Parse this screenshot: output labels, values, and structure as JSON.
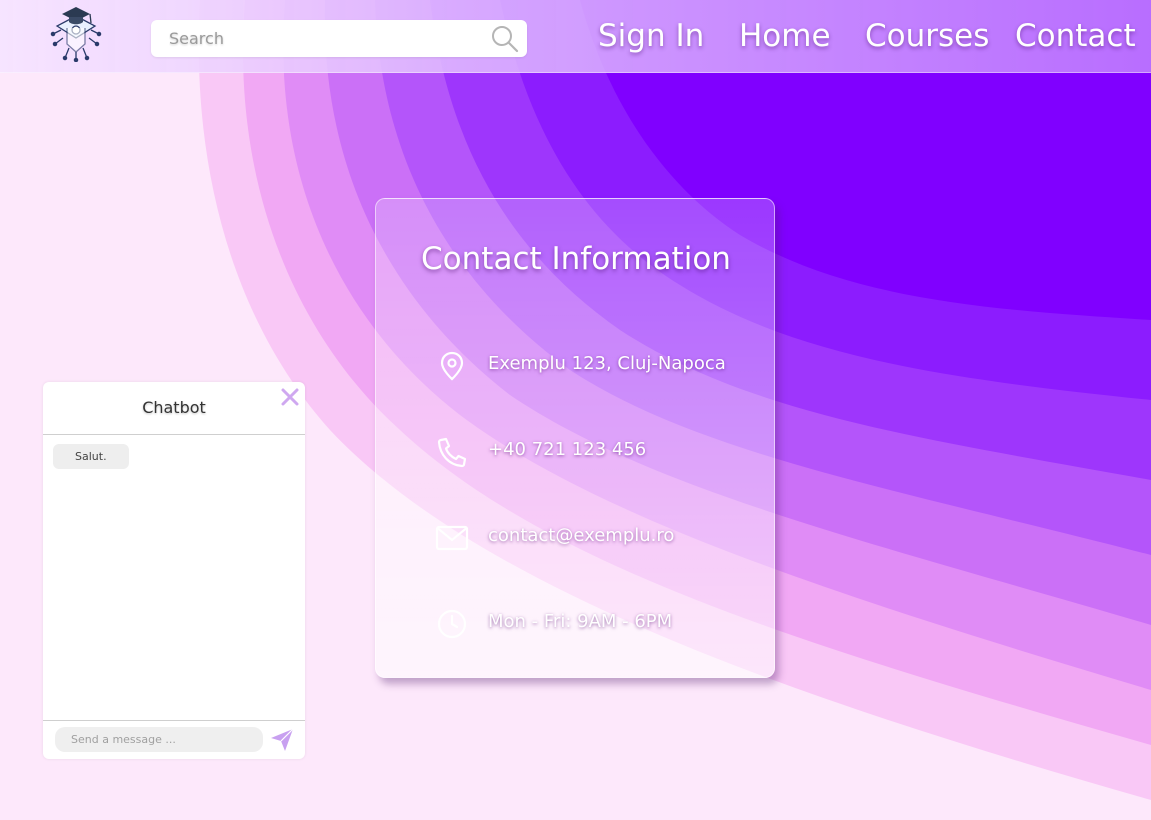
{
  "header": {
    "search": {
      "placeholder": "Search",
      "value": ""
    },
    "nav": [
      "Sign In",
      "Home",
      "Courses",
      "Contact"
    ]
  },
  "contact": {
    "title": "Contact Information",
    "address": "Exemplu 123, Cluj-Napoca",
    "phone": "+40 721 123 456",
    "email": "contact@exemplu.ro",
    "hours": "Mon - Fri: 9AM - 6PM"
  },
  "chatbot": {
    "title": "Chatbot",
    "messages": [
      "Salut."
    ],
    "input": {
      "placeholder": "Send a message ...",
      "value": ""
    }
  },
  "icons": {
    "logo": "graduation-cap-chip-logo",
    "search": "search-icon",
    "address": "location-pin-icon",
    "phone": "phone-icon",
    "email": "mail-icon",
    "hours": "clock-icon",
    "close": "close-icon",
    "send": "send-icon"
  },
  "colors": {
    "accent_purple": "#8000ff",
    "header_tint": "#e6c8ff",
    "background_pink": "#fde8fb",
    "close_icon": "#cfa8f0",
    "send_icon": "#c8a0f0"
  }
}
